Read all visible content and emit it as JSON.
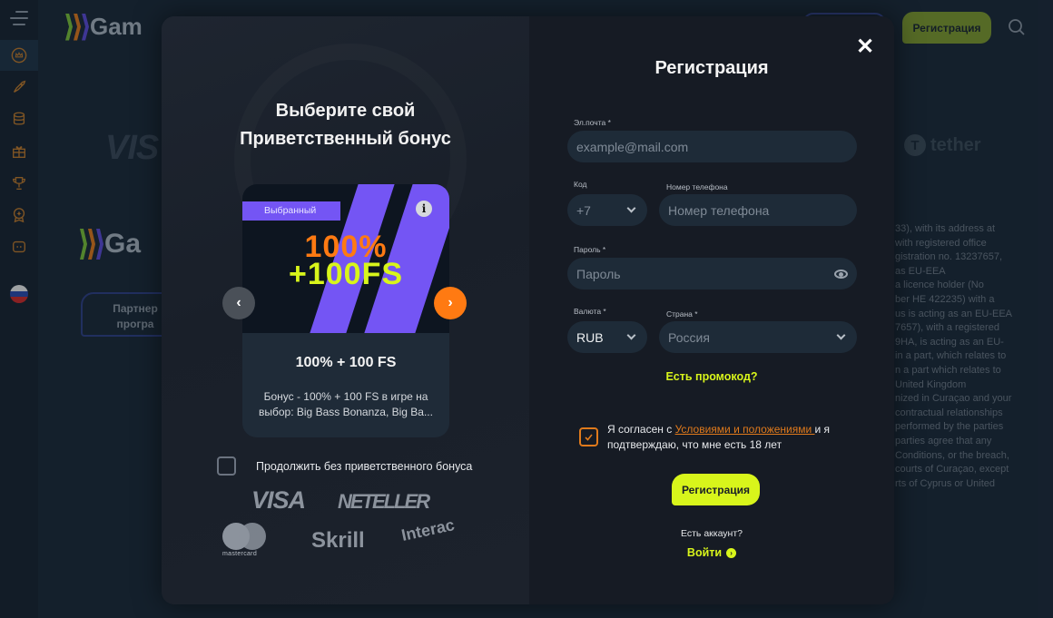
{
  "topbar": {
    "logo_text": "Gam",
    "register_label": "Регистрация",
    "search_icon": "search-icon"
  },
  "sidebar": {
    "menu_icon": "hamburger-icon",
    "items": [
      {
        "icon": "crown-icon",
        "glyph": "♛",
        "active": true
      },
      {
        "icon": "rocket-icon",
        "glyph": "🚀"
      },
      {
        "icon": "coins-icon",
        "glyph": "⛁"
      },
      {
        "icon": "gift-icon",
        "glyph": "🎁"
      },
      {
        "icon": "trophy-icon",
        "glyph": "🏆"
      },
      {
        "icon": "badge-icon",
        "glyph": "🏅"
      },
      {
        "icon": "chat-icon",
        "glyph": "💬"
      }
    ],
    "language_flag": "ru"
  },
  "background": {
    "visa_text": "VIS",
    "tether_text": "tether",
    "logo2_text": "Ga",
    "partner_button": [
      "Партнер",
      "програ"
    ],
    "legal_lines": [
      "33), with its address at",
      "with registered office",
      "gistration no. 13237657,",
      "as EU-EEA",
      "a licence holder (No",
      "ber HE 422235) with a",
      "us is acting as an EU-EEA",
      "7657), with a registered",
      "9HA, is acting as an EU-",
      "in a part, which relates to",
      "n a part which relates to",
      "United Kingdom",
      "nized in Curaçao and your",
      "contractual relationships",
      "performed by the parties",
      "parties agree that any",
      "Conditions, or the breach,",
      "courts of Curaçao, except",
      "rts of Cyprus or United"
    ]
  },
  "bonus_panel": {
    "title_line1": "Выберите свой",
    "title_line2": "Приветственный бонус",
    "card": {
      "tag": "Выбранный",
      "info_glyph": "i",
      "promo_line1": "100%",
      "promo_line2": "+100FS",
      "name": "100% + 100 FS",
      "description": "Бонус - 100% + 100 FS в игре на выбор: Big Bass Bonanza, Big Ba..."
    },
    "prev_glyph": "‹",
    "next_glyph": "›",
    "no_bonus_label": "Продолжить без приветственного бонуса",
    "no_bonus_checked": false,
    "payment_logos": [
      "VISA",
      "NETELLER",
      "mastercard",
      "Skrill",
      "Interac"
    ]
  },
  "form": {
    "close_glyph": "✕",
    "title": "Регистрация",
    "email": {
      "label": "Эл.почта *",
      "placeholder": "example@mail.com",
      "value": ""
    },
    "code": {
      "label": "Код",
      "value": "+7"
    },
    "phone": {
      "label": "Номер телефона",
      "placeholder": "Номер телефона",
      "value": ""
    },
    "password": {
      "label": "Пароль *",
      "placeholder": "Пароль",
      "value": ""
    },
    "currency": {
      "label": "Валюта *",
      "value": "RUB"
    },
    "country": {
      "label": "Страна *",
      "value": "Россия"
    },
    "promo_link": "Есть промокод?",
    "agree": {
      "checked": true,
      "prefix": "Я согласен с ",
      "link": "Условиями и положениями ",
      "suffix": "и я подтверждаю, что мне есть 18 лет"
    },
    "submit_label": "Регистрация",
    "have_account": "Есть аккаунт?",
    "login_label": "Войти"
  },
  "colors": {
    "accent_lime": "#d8f51b",
    "accent_orange": "#ff7a12",
    "accent_purple": "#7455f4"
  }
}
